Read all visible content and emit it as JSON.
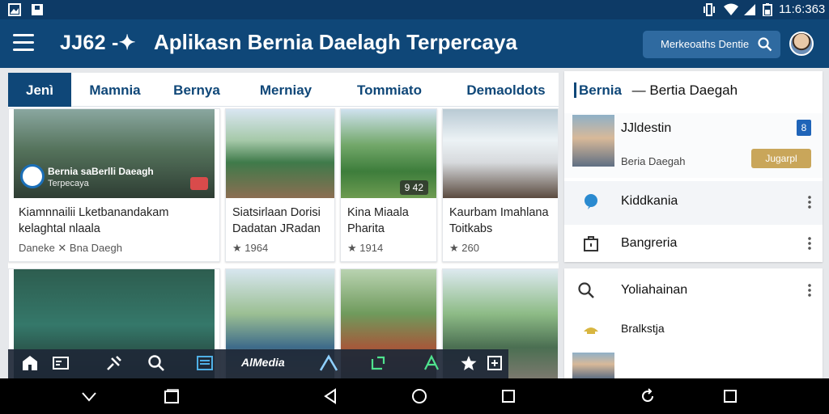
{
  "status": {
    "time": "11:6:363",
    "icons": [
      "gallery-icon",
      "card-icon",
      "vibrate-icon",
      "wifi-icon",
      "signal-icon",
      "battery-icon"
    ]
  },
  "appbar": {
    "brand": "JJ62 -✦",
    "title": "Aplikasn Bernia Daelagh Terpercaya",
    "search_label": "Merkeoaths Dentie",
    "accent": "#0f4778"
  },
  "tabs": [
    "Jenì",
    "Mamnia",
    "Bernya",
    "Merniay",
    "Tommiato",
    "Demaoldots"
  ],
  "cards": [
    {
      "caption": [
        "Kiamnnailii Lketbanandakam",
        "kelaghtal nlaala"
      ],
      "meta": "Daneke  ✕ Bna Daegh",
      "overlay_title": "Bernia saBerlli Daeagh",
      "overlay_sub": "Terpecaya"
    },
    {
      "caption": [
        "Siatsirlaan Dorisi",
        "Dadatan JRadan"
      ],
      "meta": "★ 1964"
    },
    {
      "caption": [
        "Kina Miaala",
        "Pharita"
      ],
      "meta": "★ 1914",
      "badge": "9 42"
    },
    {
      "caption": [
        "Kaurbam Imahlana",
        "Toitkabs"
      ],
      "meta": "★ 260"
    }
  ],
  "bottom_bar": {
    "items": [
      "home-icon",
      "card-icon",
      "pin-icon",
      "search-icon",
      "list-icon"
    ],
    "label": "AlMedia",
    "icons_right": [
      "triangle-icon",
      "share-icon",
      "a-icon",
      "star-icon",
      "crop-icon"
    ]
  },
  "side_panel": {
    "head_accent": "Bernia",
    "head_rest": "—  Bertia Daegah",
    "item1_title": "JJldestin",
    "item1_sub": "Beria Daegah",
    "item1_count": "8",
    "follow_label": "Jugarpl",
    "rows": [
      {
        "label": "Kiddkania",
        "icon": "chat-icon"
      },
      {
        "label": "Bangreria",
        "icon": "bag-icon"
      }
    ]
  },
  "side_panel2": {
    "rows": [
      {
        "label": "Yoliahainan",
        "icon": "search-icon"
      },
      {
        "label": "Bralkstja",
        "icon": "hat-icon"
      }
    ]
  }
}
